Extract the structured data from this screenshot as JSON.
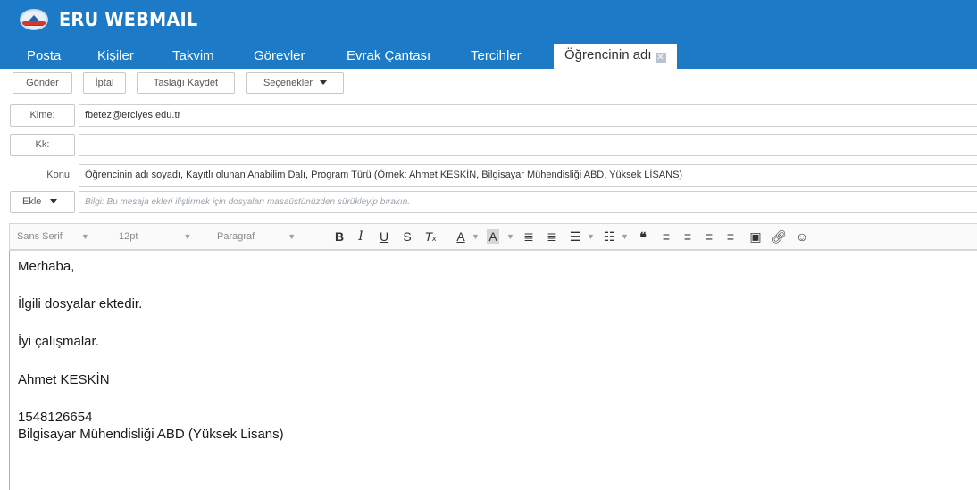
{
  "app": {
    "title": "ERU WEBMAIL",
    "logo_icon": "university-logo"
  },
  "tabs": [
    {
      "label": "Posta"
    },
    {
      "label": "Kişiler"
    },
    {
      "label": "Takvim"
    },
    {
      "label": "Görevler"
    },
    {
      "label": "Evrak Çantası"
    },
    {
      "label": "Tercihler"
    },
    {
      "label": "Öğrencinin adı",
      "active": true,
      "close_icon": "close-icon"
    }
  ],
  "toolbar": {
    "send": "Gönder",
    "cancel": "İptal",
    "save_draft": "Taslağı Kaydet",
    "options": "Seçenekler"
  },
  "compose": {
    "to_label": "Kime:",
    "to_value": "fbetez@erciyes.edu.tr",
    "cc_label": "Kk:",
    "cc_value": "",
    "subject_label": "Konu:",
    "subject_value": "Öğrencinin adı soyadı, Kayıtlı olunan Anabilim Dalı, Program Türü (Örnek: Ahmet KESKİN, Bilgisayar Mühendisliği ABD, Yüksek LİSANS)",
    "attach_label": "Ekle",
    "attach_hint": "Bilgi: Bu mesaja ekleri iliştirmek için dosyaları masaüstünüzden sürükleyip bırakın."
  },
  "editor_toolbar": {
    "font_family": "Sans Serif",
    "font_size": "12pt",
    "block_format": "Paragraf"
  },
  "body": {
    "greeting": "Merhaba,",
    "line1": "İlgili dosyalar ektedir.",
    "line2": "İyi çalışmalar.",
    "name": "Ahmet KESKİN",
    "number": "1548126654",
    "department": "Bilgisayar Mühendisliği ABD (Yüksek Lisans)"
  },
  "colors": {
    "header": "#1d7ac6"
  }
}
